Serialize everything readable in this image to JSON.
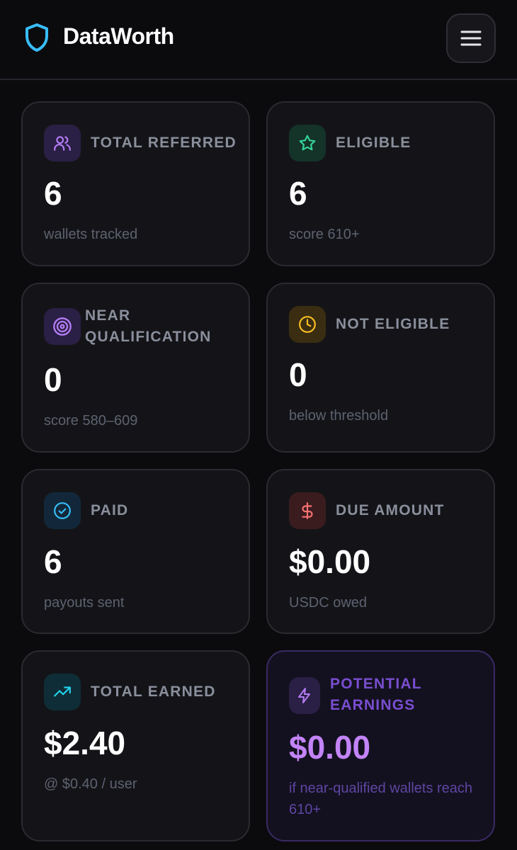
{
  "header": {
    "brand": "DataWorth",
    "logo_icon": "shield-icon",
    "menu_icon": "menu-icon"
  },
  "cards": [
    {
      "label": "TOTAL REFERRED",
      "value": "6",
      "sub": "wallets tracked",
      "icon": "users-icon",
      "accent": "#b47cf5",
      "icon_bg": "#2a1f44"
    },
    {
      "label": "ELIGIBLE",
      "value": "6",
      "sub": "score 610+",
      "icon": "star-icon",
      "accent": "#34d399",
      "icon_bg": "#143329"
    },
    {
      "label": "NEAR QUALIFICATION",
      "value": "0",
      "sub": "score 580–609",
      "icon": "target-icon",
      "accent": "#b47cf5",
      "icon_bg": "#2a1f44"
    },
    {
      "label": "NOT ELIGIBLE",
      "value": "0",
      "sub": "below threshold",
      "icon": "clock-icon",
      "accent": "#fbbf24",
      "icon_bg": "#3a2d12"
    },
    {
      "label": "PAID",
      "value": "6",
      "sub": "payouts sent",
      "icon": "check-circle-icon",
      "accent": "#38bdf8",
      "icon_bg": "#12283a"
    },
    {
      "label": "DUE AMOUNT",
      "value": "$0.00",
      "sub": "USDC owed",
      "icon": "dollar-icon",
      "accent": "#f87171",
      "icon_bg": "#3a1c1f"
    },
    {
      "label": "TOTAL EARNED",
      "value": "$2.40",
      "sub": "@ $0.40 / user",
      "icon": "trending-up-icon",
      "accent": "#22d3ee",
      "icon_bg": "#0f2d36"
    },
    {
      "label": "POTENTIAL EARNINGS",
      "value": "$0.00",
      "sub": "if near-qualified wallets reach 610+",
      "icon": "lightning-icon",
      "accent": "#b47cf5",
      "icon_bg": "#2a1f44"
    }
  ]
}
